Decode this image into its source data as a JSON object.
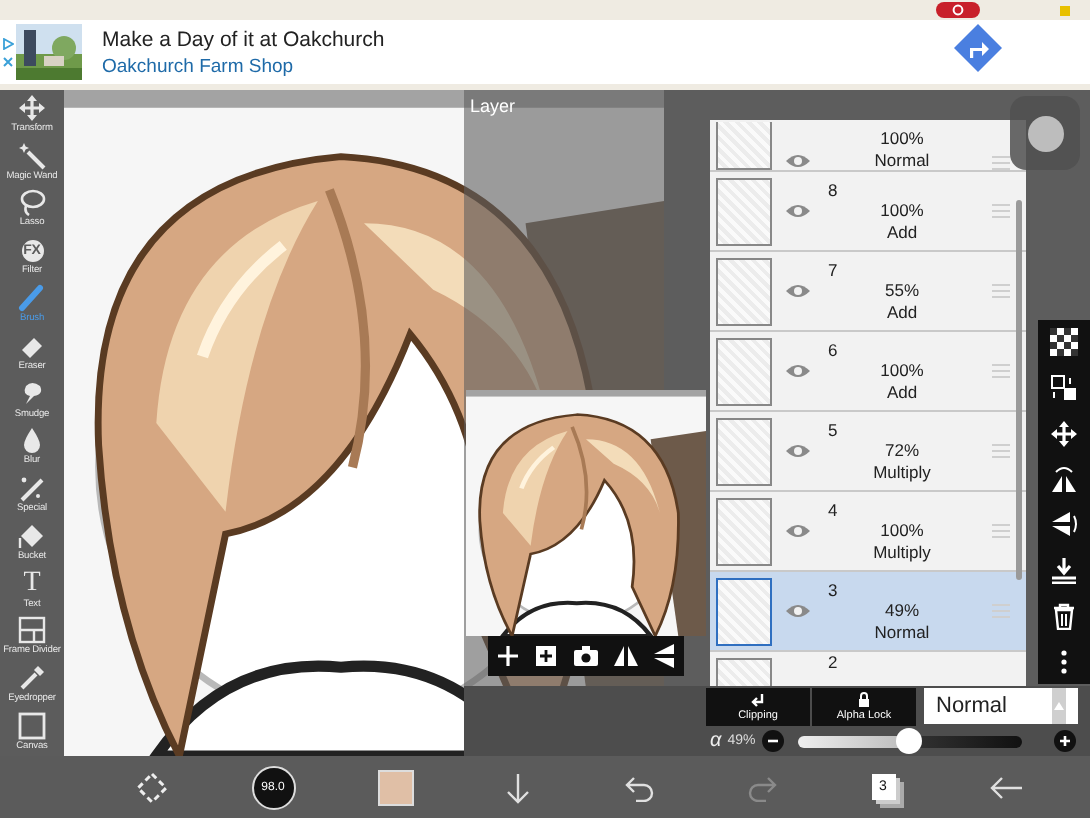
{
  "ad": {
    "title": "Make a Day of it at Oakchurch",
    "subtitle": "Oakchurch Farm Shop"
  },
  "tools": [
    {
      "label": "Transform",
      "selected": false
    },
    {
      "label": "Magic Wand",
      "selected": false
    },
    {
      "label": "Lasso",
      "selected": false
    },
    {
      "label": "Filter",
      "selected": false,
      "icon_text": "FX"
    },
    {
      "label": "Brush",
      "selected": true
    },
    {
      "label": "Eraser",
      "selected": false
    },
    {
      "label": "Smudge",
      "selected": false
    },
    {
      "label": "Blur",
      "selected": false
    },
    {
      "label": "Special",
      "selected": false
    },
    {
      "label": "Bucket",
      "selected": false
    },
    {
      "label": "Text",
      "selected": false,
      "icon_text": "T"
    },
    {
      "label": "Frame Divider",
      "selected": false
    },
    {
      "label": "Eyedropper",
      "selected": false
    },
    {
      "label": "Canvas",
      "selected": false
    }
  ],
  "layer_panel": {
    "title": "Layer",
    "layers": [
      {
        "opacity": "100%",
        "blend": "Normal",
        "visible": true,
        "selected": false
      },
      {
        "number": "8",
        "opacity": "100%",
        "blend": "Add",
        "visible": true,
        "selected": false
      },
      {
        "number": "7",
        "opacity": "55%",
        "blend": "Add",
        "visible": true,
        "selected": false
      },
      {
        "number": "6",
        "opacity": "100%",
        "blend": "Add",
        "visible": true,
        "selected": false
      },
      {
        "number": "5",
        "opacity": "72%",
        "blend": "Multiply",
        "visible": true,
        "selected": false
      },
      {
        "number": "4",
        "opacity": "100%",
        "blend": "Multiply",
        "visible": true,
        "selected": false
      },
      {
        "number": "3",
        "opacity": "49%",
        "blend": "Normal",
        "visible": true,
        "selected": true
      },
      {
        "number": "2",
        "selected": false
      }
    ],
    "clipping": "Clipping",
    "alpha_lock": "Alpha Lock",
    "blend_mode": "Normal",
    "opacity": {
      "label": "α",
      "reading": "49%",
      "level": 0.49
    }
  },
  "bottom_bar": {
    "brush_size": "98.0",
    "color": "#e0bfa6",
    "layers_count": "3",
    "undo": {
      "disabled": false
    },
    "redo": {
      "disabled": true
    }
  }
}
